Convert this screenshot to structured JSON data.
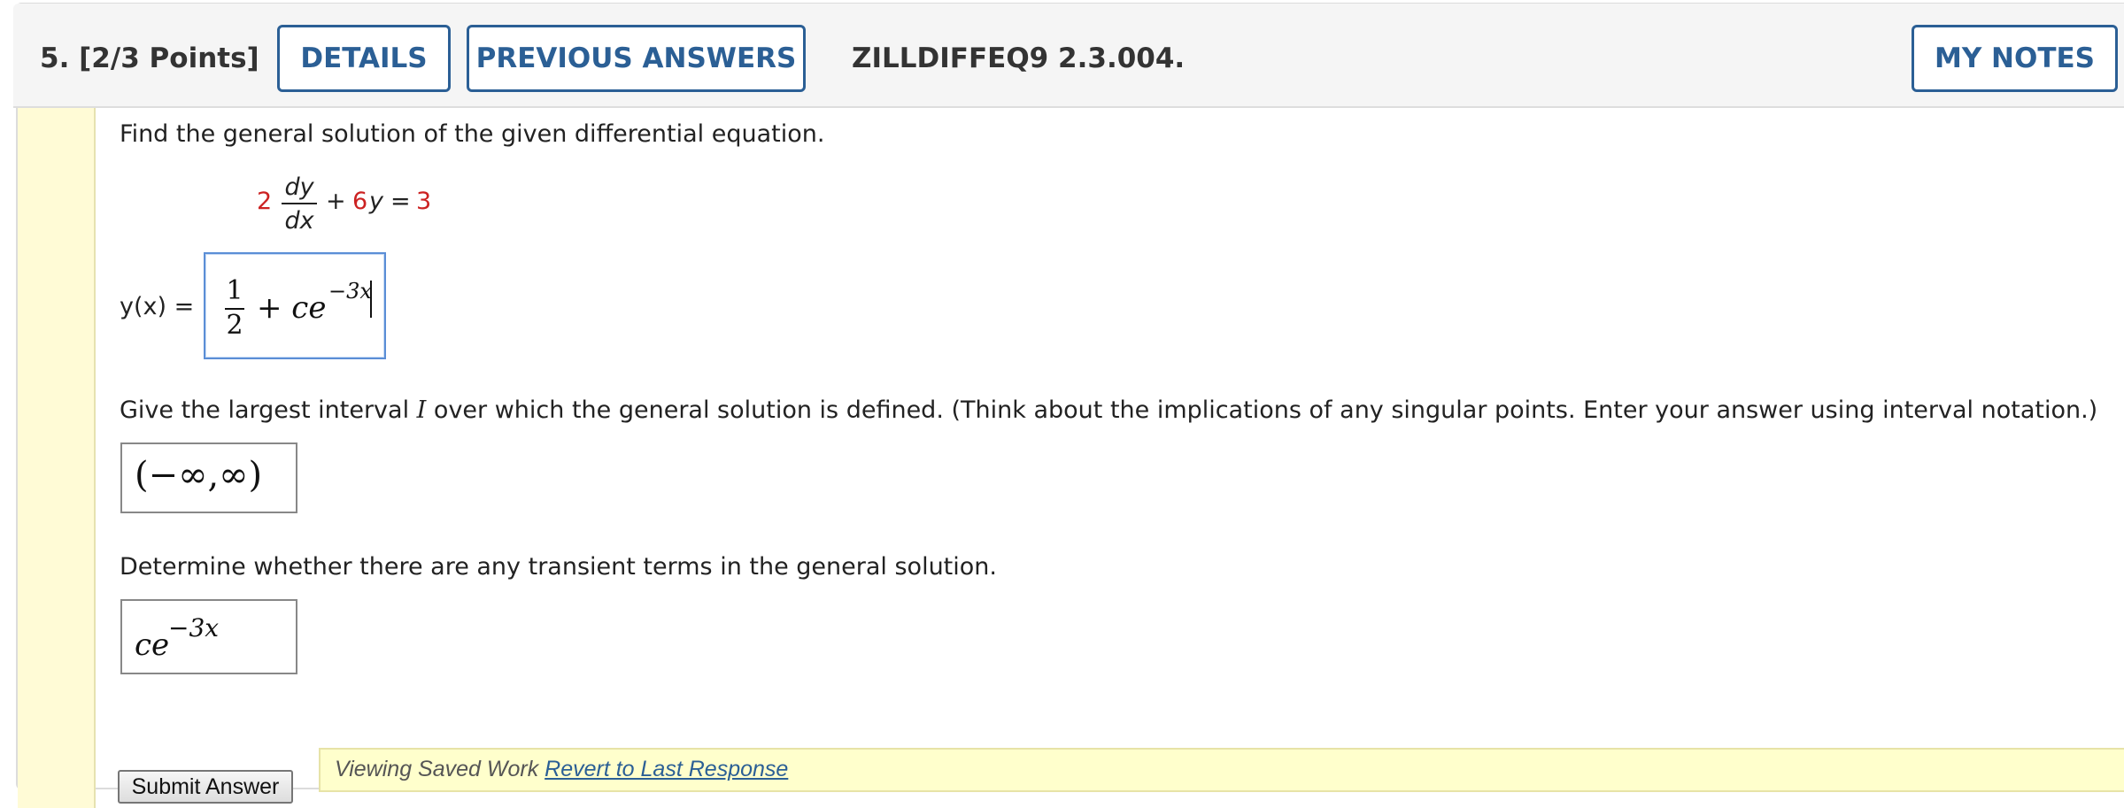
{
  "header": {
    "question_label": "5.  [2/3 Points]",
    "details_label": "DETAILS",
    "previous_answers_label": "PREVIOUS ANSWERS",
    "question_code": "ZILLDIFFEQ9 2.3.004.",
    "my_notes_label": "MY NOTES"
  },
  "question": {
    "prompt": "Find the general solution of the given differential equation.",
    "equation": {
      "coef_a": "2",
      "numerator": "dy",
      "denominator": "dx",
      "plus": "+",
      "coef_b": "6",
      "var_y": "y",
      "equals": "=",
      "rhs": "3"
    },
    "part1": {
      "lhs": "y(x) =",
      "answer_num": "1",
      "answer_den": "2",
      "answer_rest": "+ ce",
      "answer_exp": "−3x"
    },
    "part2": {
      "prompt_a": "Give the largest interval ",
      "prompt_var": "I",
      "prompt_b": " over which the general solution is defined. (Think about the implications of any singular points. Enter your answer using interval notation.)",
      "answer": "(−∞,∞)"
    },
    "part3": {
      "prompt": "Determine whether there are any transient terms in the general solution.",
      "answer_base": "ce",
      "answer_exp": "−3x"
    }
  },
  "footer": {
    "submit_label": "Submit Answer",
    "saved_text": "Viewing Saved Work ",
    "revert_link": "Revert to Last Response"
  },
  "colors": {
    "accent": "#2b5f95",
    "coefficient_red": "#cc2222",
    "sidebar_yellow": "#fffbd6",
    "saved_bar_yellow": "#ffffcc"
  }
}
